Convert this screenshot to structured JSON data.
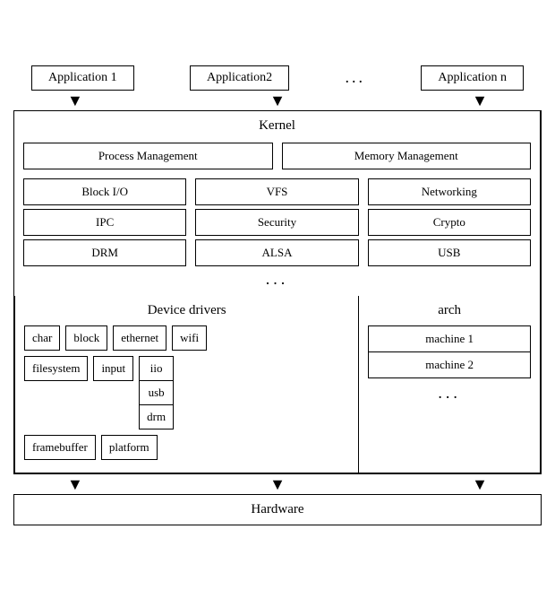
{
  "apps": {
    "app1": "Application 1",
    "app2": "Application2",
    "dots": "...",
    "appn": "Application n"
  },
  "kernel": {
    "title": "Kernel",
    "row1": [
      "Process Management",
      "Memory Management"
    ],
    "row2": [
      "Block I/O",
      "VFS",
      "Networking"
    ],
    "row3": [
      "IPC",
      "Security",
      "Crypto"
    ],
    "row4": [
      "DRM",
      "ALSA",
      "USB"
    ],
    "dots": "..."
  },
  "device_drivers": {
    "title": "Device drivers",
    "row1": [
      "char",
      "block",
      "ethernet",
      "wifi"
    ],
    "row2_left": [
      "filesystem",
      "input"
    ],
    "stacked": [
      "iio",
      "usb",
      "drm"
    ],
    "row3_left": [
      "framebuffer",
      "platform"
    ]
  },
  "arch": {
    "title": "arch",
    "machines": [
      "machine 1",
      "machine 2"
    ],
    "dots": "..."
  },
  "hardware": {
    "label": "Hardware"
  }
}
